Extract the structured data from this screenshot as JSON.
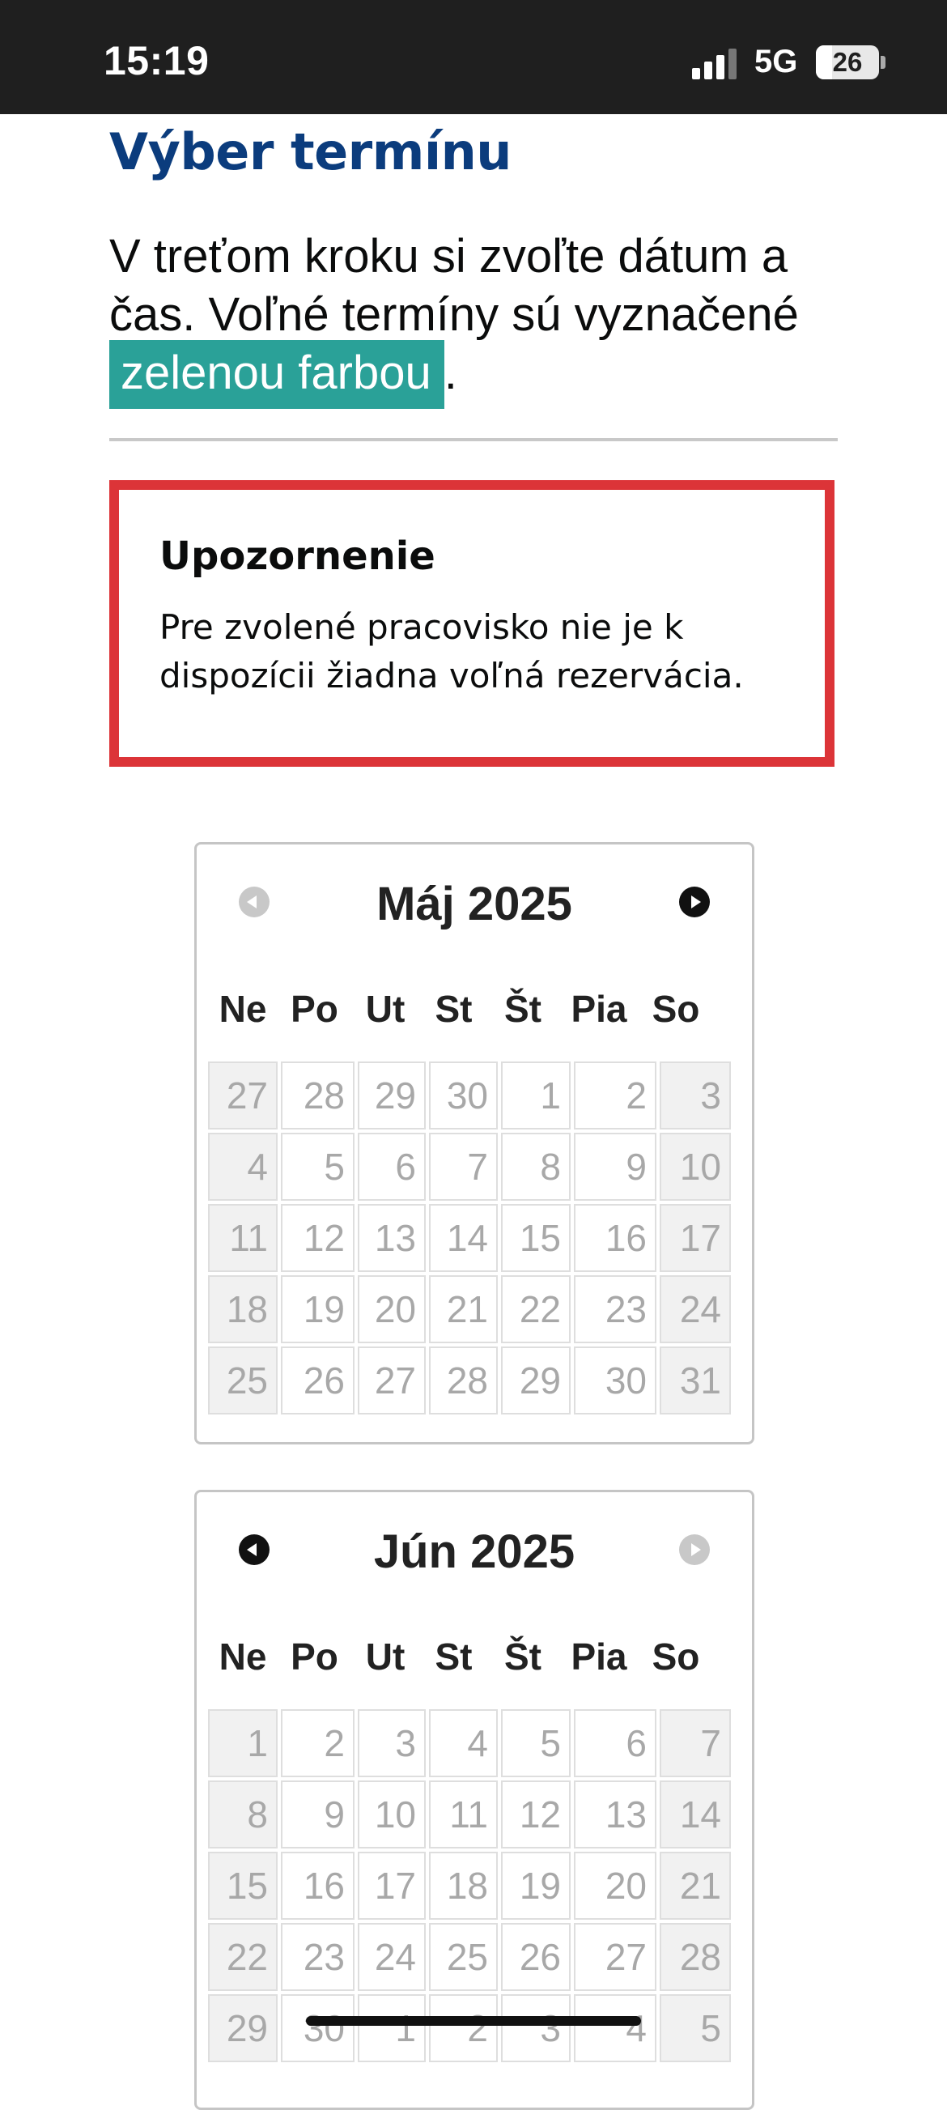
{
  "status_bar": {
    "time": "15:19",
    "network": "5G",
    "battery": "26",
    "battery_level": 26
  },
  "page": {
    "title": "Výber termínu",
    "intro_text": "V treťom kroku si zvoľte dátum a čas. Voľné termíny sú vyznačené ",
    "intro_highlight": "zelenou farbou",
    "intro_end": "."
  },
  "warning": {
    "title": "Upozornenie",
    "body": "Pre zvolené pracovisko nie je k dispozícii žiadna voľná rezervácia."
  },
  "colors": {
    "title": "#0b3c7d",
    "highlight": "#2aa198",
    "warning_border": "#dc3438",
    "disabled_day": "#a8a8a8"
  },
  "calendars": [
    {
      "title": "Máj 2025",
      "prev_enabled": false,
      "next_enabled": true,
      "weekdays": [
        "Ne",
        "Po",
        "Ut",
        "St",
        "Št",
        "Pia",
        "So"
      ],
      "weeks": [
        [
          "27",
          "28",
          "29",
          "30",
          "1",
          "2",
          "3"
        ],
        [
          "4",
          "5",
          "6",
          "7",
          "8",
          "9",
          "10"
        ],
        [
          "11",
          "12",
          "13",
          "14",
          "15",
          "16",
          "17"
        ],
        [
          "18",
          "19",
          "20",
          "21",
          "22",
          "23",
          "24"
        ],
        [
          "25",
          "26",
          "27",
          "28",
          "29",
          "30",
          "31"
        ]
      ]
    },
    {
      "title": "Jún 2025",
      "prev_enabled": true,
      "next_enabled": false,
      "weekdays": [
        "Ne",
        "Po",
        "Ut",
        "St",
        "Št",
        "Pia",
        "So"
      ],
      "weeks": [
        [
          "1",
          "2",
          "3",
          "4",
          "5",
          "6",
          "7"
        ],
        [
          "8",
          "9",
          "10",
          "11",
          "12",
          "13",
          "14"
        ],
        [
          "15",
          "16",
          "17",
          "18",
          "19",
          "20",
          "21"
        ],
        [
          "22",
          "23",
          "24",
          "25",
          "26",
          "27",
          "28"
        ],
        [
          "29",
          "30",
          "1",
          "2",
          "3",
          "4",
          "5"
        ]
      ]
    }
  ]
}
